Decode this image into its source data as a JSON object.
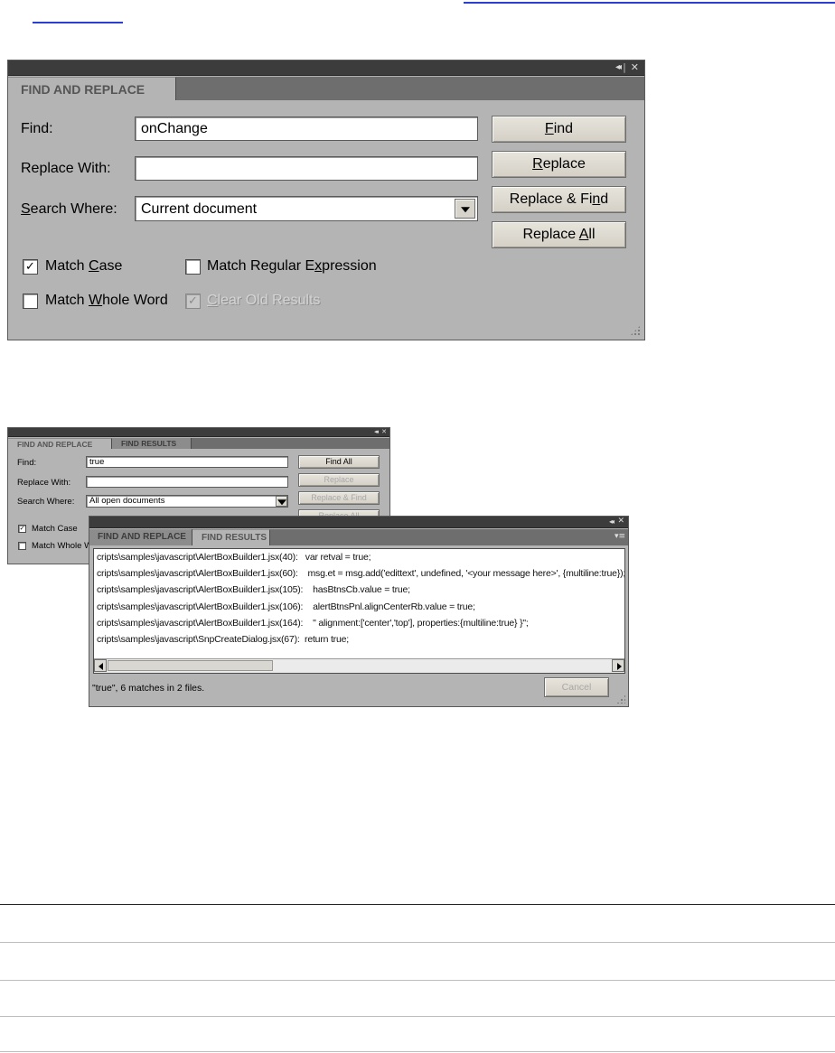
{
  "panel1": {
    "title_controls": {
      "collapse": "◂◂",
      "sep": "|",
      "close": "✕"
    },
    "tab_label": "FIND AND REPLACE",
    "find_label": "Find:",
    "find_value": "onChange",
    "replace_label": "Replace With:",
    "replace_value": "",
    "search_label_pre": "",
    "search_label_u": "S",
    "search_label_post": "earch Where:",
    "search_value": "Current document",
    "buttons": {
      "find": {
        "pre": "",
        "u": "F",
        "post": "ind"
      },
      "replace": {
        "pre": "",
        "u": "R",
        "post": "eplace"
      },
      "replace_find": {
        "pre": "Replace & Fi",
        "u": "n",
        "post": "d"
      },
      "replace_all": {
        "pre": "Replace ",
        "u": "A",
        "post": "ll"
      }
    },
    "match_case": {
      "checked": true,
      "pre": "Match ",
      "u": "C",
      "post": "ase"
    },
    "match_regex": {
      "checked": false,
      "pre": "Match Regular E",
      "u": "x",
      "post": "pression"
    },
    "match_whole": {
      "checked": false,
      "pre": "Match ",
      "u": "W",
      "post": "hole Word"
    },
    "clear_old": {
      "checked": true,
      "disabled": true,
      "pre": "",
      "u": "C",
      "post": "lear Old Results"
    }
  },
  "panel2": {
    "title_controls": {
      "collapse": "◂◂",
      "sep": "|",
      "close": "✕"
    },
    "tab_active": "FIND AND REPLACE",
    "tab_inactive": "FIND RESULTS",
    "find_label": "Find:",
    "find_value": "true",
    "replace_label": "Replace With:",
    "replace_value": "",
    "search_label": "Search Where:",
    "search_value": "All open documents",
    "buttons": {
      "find_all": "Find All",
      "replace": "Replace",
      "replace_find": "Replace & Find",
      "replace_all": "Replace All"
    },
    "match_case": "Match Case",
    "match_whole": "Match Whole W"
  },
  "panel3": {
    "title_controls": {
      "collapse": "◂◂",
      "sep": "|",
      "close": "✕"
    },
    "tab_inactive": "FIND AND REPLACE",
    "tab_active": "FIND RESULTS",
    "menu_icon": "▾≡",
    "results": [
      "cripts\\samples\\javascript\\AlertBoxBuilder1.jsx(40):   var retval = true;",
      "cripts\\samples\\javascript\\AlertBoxBuilder1.jsx(60):    msg.et = msg.add('edittext', undefined, '<your message here>', {multiline:true});",
      "cripts\\samples\\javascript\\AlertBoxBuilder1.jsx(105):    hasBtnsCb.value = true;",
      "cripts\\samples\\javascript\\AlertBoxBuilder1.jsx(106):    alertBtnsPnl.alignCenterRb.value = true;",
      "cripts\\samples\\javascript\\AlertBoxBuilder1.jsx(164):    \" alignment:['center','top'], properties:{multiline:true} }\";",
      "cripts\\samples\\javascript\\SnpCreateDialog.jsx(67):  return true;"
    ],
    "status": "\"true\", 6 matches in 2 files.",
    "cancel": "Cancel"
  }
}
